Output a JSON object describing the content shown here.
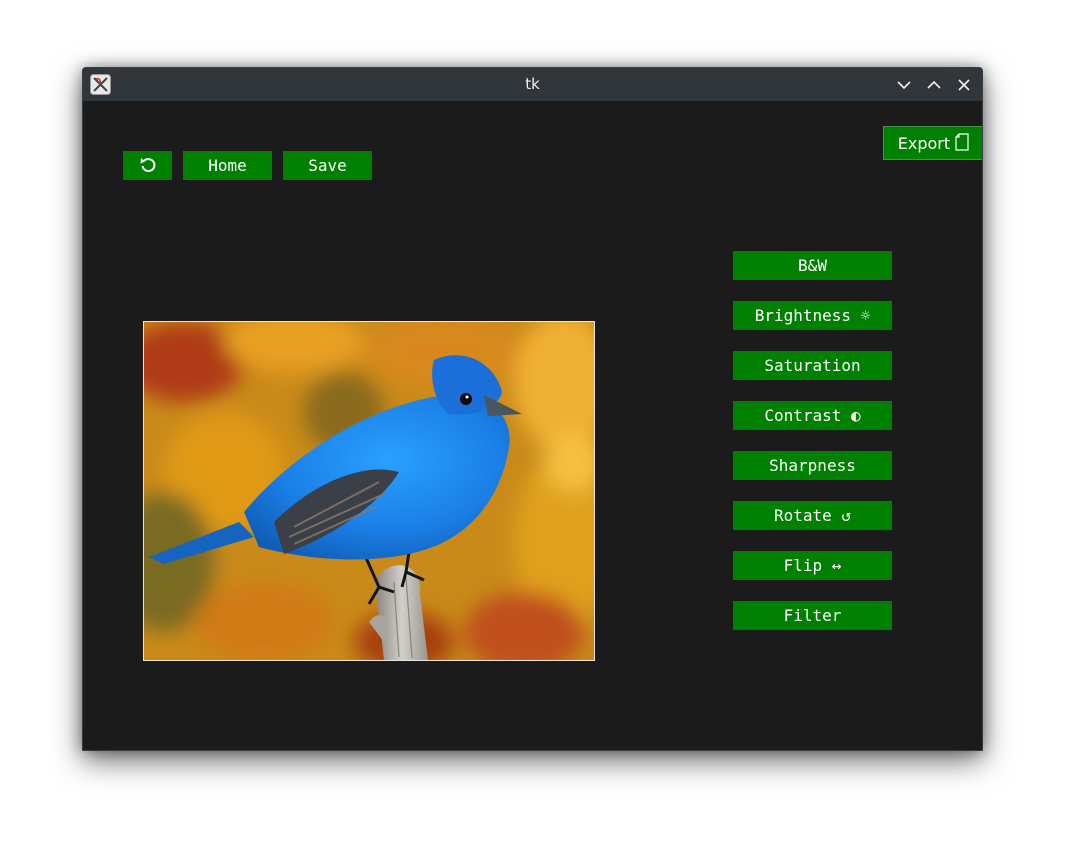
{
  "window": {
    "title": "tk",
    "icons": {
      "app": "tk-app-icon",
      "minimize": "chevron-down-icon",
      "maximize": "chevron-up-icon",
      "close": "close-icon"
    }
  },
  "toolbar": {
    "undo_icon": "undo-icon",
    "undo_glyph": "⟲",
    "home_label": "Home",
    "save_label": "Save"
  },
  "export": {
    "label": "Export",
    "icon": "document-icon"
  },
  "tools": [
    {
      "label": "B&W"
    },
    {
      "label": "Brightness ☼"
    },
    {
      "label": "Saturation"
    },
    {
      "label": "Contrast ◐"
    },
    {
      "label": "Sharpness"
    },
    {
      "label": "Rotate ↺"
    },
    {
      "label": "Flip ↔"
    },
    {
      "label": "Filter"
    }
  ],
  "image": {
    "subject": "blue bird on branch"
  },
  "colors": {
    "button_bg": "#008000",
    "button_text": "#ffffff",
    "window_bg": "#1b1b1b",
    "titlebar_bg": "#31363b"
  }
}
